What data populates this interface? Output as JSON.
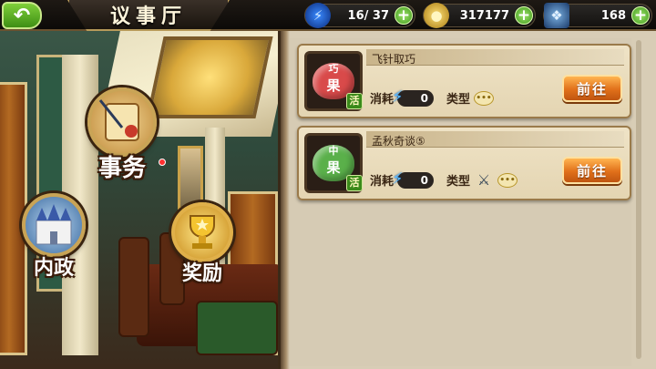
{
  "header": {
    "back_icon": "back-arrow-icon",
    "title": "议事厅"
  },
  "resources": {
    "energy": {
      "icon": "lightning-icon",
      "value": "16/ 37"
    },
    "gold": {
      "icon": "gold-coin-icon",
      "value": "317177"
    },
    "gems": {
      "icon": "crystal-icon",
      "value": "168"
    }
  },
  "menu": {
    "affairs": {
      "label": "事务",
      "icon": "scroll-icon",
      "has_notification": true
    },
    "domestic": {
      "label": "内政",
      "icon": "castle-icon"
    },
    "rewards": {
      "label": "奖励",
      "icon": "trophy-icon"
    }
  },
  "tasks": [
    {
      "title": "飞针取巧",
      "fruit_color": "#d94a4a",
      "fruit_label": "果",
      "fruit_top": "巧",
      "badge": "活",
      "cost_label": "消耗",
      "cost_value": "0",
      "type_label": "类型",
      "type_icons": [
        "speech-bubble-icon"
      ],
      "go_label": "前往"
    },
    {
      "title": "孟秋奇谈⑤",
      "fruit_color": "#5ab04a",
      "fruit_label": "果",
      "fruit_top": "中",
      "badge": "活",
      "cost_label": "消耗",
      "cost_value": "0",
      "type_label": "类型",
      "type_icons": [
        "crossed-swords-icon",
        "speech-bubble-icon"
      ],
      "go_label": "前往"
    }
  ],
  "colors": {
    "accent_green": "#3e8f14",
    "go_button": "#e0701a",
    "panel_bg": "#d6cbb4"
  }
}
